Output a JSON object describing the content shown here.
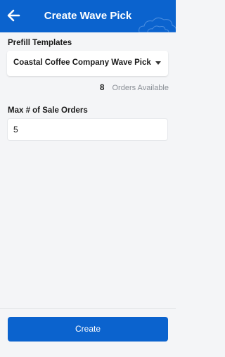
{
  "header": {
    "title": "Create Wave Pick",
    "back_icon": "arrow-left-icon",
    "decoration_icon": "cloud-icon",
    "background_color": "#0b63ce"
  },
  "templates": {
    "label": "Prefill Templates",
    "selected": "Coastal Coffee Company Wave Pick"
  },
  "orders": {
    "count": "8",
    "label": "Orders Available"
  },
  "max_orders": {
    "label": "Max # of Sale Orders",
    "value": "5"
  },
  "footer": {
    "create_label": "Create",
    "button_color": "#0b63ce"
  }
}
